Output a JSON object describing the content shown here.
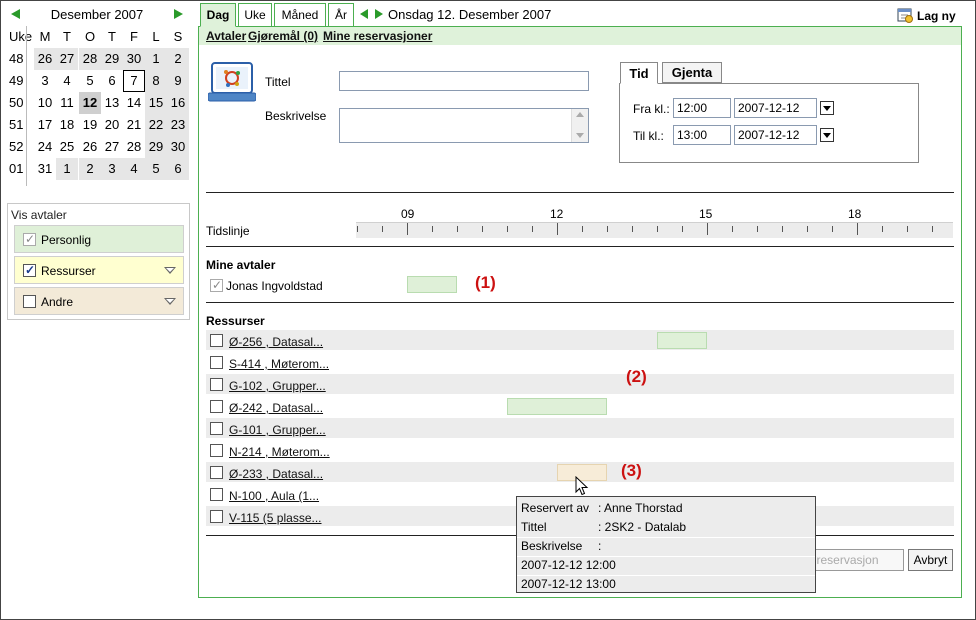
{
  "calendar": {
    "month_title": "Desember 2007",
    "week_header": "Uke",
    "day_headers": [
      "M",
      "T",
      "O",
      "T",
      "F",
      "L",
      "S"
    ],
    "weeks": [
      {
        "week": "48",
        "days": [
          "26",
          "27",
          "28",
          "29",
          "30",
          "1",
          "2"
        ]
      },
      {
        "week": "49",
        "days": [
          "3",
          "4",
          "5",
          "6",
          "7",
          "8",
          "9"
        ]
      },
      {
        "week": "50",
        "days": [
          "10",
          "11",
          "12",
          "13",
          "14",
          "15",
          "16"
        ]
      },
      {
        "week": "51",
        "days": [
          "17",
          "18",
          "19",
          "20",
          "21",
          "22",
          "23"
        ]
      },
      {
        "week": "52",
        "days": [
          "24",
          "25",
          "26",
          "27",
          "28",
          "29",
          "30"
        ]
      },
      {
        "week": "01",
        "days": [
          "31",
          "1",
          "2",
          "3",
          "4",
          "5",
          "6"
        ]
      }
    ]
  },
  "vis_avtaler": {
    "title": "Vis avtaler",
    "items": [
      {
        "label": "Personlig",
        "checked": true,
        "color": "#dff0d8"
      },
      {
        "label": "Ressurser",
        "checked": true,
        "color": "#ffffd0"
      },
      {
        "label": "Andre",
        "checked": false,
        "color": "#f3ead8"
      }
    ]
  },
  "tabs": {
    "items": [
      "Dag",
      "Uke",
      "Måned",
      "År"
    ],
    "active": "Dag",
    "date_label": "Onsdag 12. Desember 2007"
  },
  "toolbar": {
    "new_label": "Lag ny"
  },
  "subnav": {
    "links": [
      "Avtaler",
      "Gjøremål (0)",
      "Mine reservasjoner"
    ]
  },
  "form": {
    "title_label": "Tittel",
    "title_value": "",
    "description_label": "Beskrivelse",
    "description_value": "",
    "time_tabs": [
      "Tid",
      "Gjenta"
    ],
    "from_label": "Fra kl.:",
    "from_time": "12:00",
    "from_date": "2007-12-12",
    "to_label": "Til kl.:",
    "to_time": "13:00",
    "to_date": "2007-12-12"
  },
  "timeline": {
    "label": "Tidslinje",
    "hour_labels": [
      "09",
      "12",
      "15",
      "18"
    ]
  },
  "mine_avtaler": {
    "title": "Mine avtaler",
    "person": "Jonas Ingvoldstad",
    "marker": "(1)"
  },
  "ressurser": {
    "title": "Ressurser",
    "marker_rooms": "(2)",
    "marker_booking": "(3)",
    "items": [
      "Ø-256 , Datasal...",
      "S-414 , Møterom...",
      "G-102 , Grupper...",
      "Ø-242 , Datasal...",
      "G-101 , Grupper...",
      "N-214 , Møterom...",
      "Ø-233 , Datasal...",
      "N-100 , Aula (1...",
      "V-115 (5 plasse..."
    ]
  },
  "tooltip": {
    "reserved_by_label": "Reservert av",
    "reserved_by": ": Anne Thorstad",
    "title_label": "Tittel",
    "title_value": ": 2SK2 - Datalab",
    "desc_label": "Beskrivelse",
    "desc_value": ":",
    "start": "2007-12-12 12:00",
    "end": "2007-12-12 13:00"
  },
  "buttons": {
    "save": "Lagre reservasjon",
    "cancel": "Avbryt"
  },
  "colors": {
    "accent": "#4caf50",
    "tab_active_bg": "#dff2da",
    "marker": "#cc1111"
  }
}
